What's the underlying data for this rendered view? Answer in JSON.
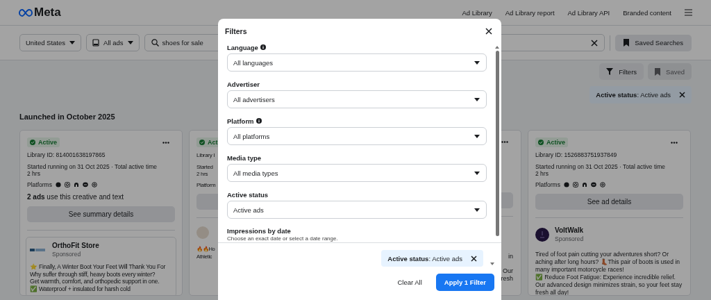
{
  "header": {
    "logo": "Meta",
    "nav": [
      "Ad Library",
      "Ad Library report",
      "Ad Library API",
      "Branded content"
    ]
  },
  "search_bar": {
    "country": "United States",
    "ad_category": "All ads",
    "query": "shoes for sale",
    "saved_searches": "Saved Searches"
  },
  "toolbar": {
    "filters": "Filters",
    "saved": {
      "label": "Saved",
      "disabled": true
    }
  },
  "active_filter_chip": "**Active status**: Active ads",
  "section_title": "Launched in October 2025",
  "cards": [
    {
      "kind": "full",
      "status": "Active",
      "library_id": "Library ID: 814001638197865",
      "started": "Started running on 31 Oct 2025 · Total active time",
      "duration": "2 hrs",
      "platforms_label": "Platforms",
      "summary": "**2 ads** use this creative and text",
      "button": "See summary details",
      "ad": {
        "framed": true,
        "advertiser": "OrthoFit Store",
        "sponsored": "Sponsored",
        "body": "⭐ Finally, A Winter Boot Your Feet Will Thank You For\nWhy suffer through stiff, heavy boots every winter?\nGet warmth, comfort, and orthopedic support in one.\n✅ Waterproof + insulated for harsh cold"
      }
    },
    {
      "kind": "clipped_left",
      "status": "Act",
      "lines": [
        "Library I",
        "Started",
        "2 hrs",
        "Platform"
      ],
      "ad_lines": [
        "🔥🔥Ho",
        "Athletic"
      ]
    },
    {
      "kind": "clipped_right",
      "lines": [
        "in",
        "Our",
        "resh"
      ]
    },
    {
      "kind": "full",
      "status": "Active",
      "library_id": "Library ID: 1526883751937849",
      "started": "Started running on 31 Oct 2025 · Total active time",
      "duration": "2 hrs",
      "platforms_label": "Platforms",
      "button": "See ad details",
      "ad": {
        "framed": false,
        "advertiser": "VoltWalk",
        "sponsored": "Sponsored",
        "body": "Tired of foot pain cutting your adventures short? Or aching after long hours? 👢This pair of boots is used in many important motorcycle races!\n✅ Reduce Foot Fatigue: Experience incredible relief. Our advanced design minimizes strain, so your feet stay fresh all day!"
      }
    }
  ],
  "filters_dialog": {
    "title": "Filters",
    "fields": [
      {
        "label": "Language",
        "info": true,
        "value": "All languages"
      },
      {
        "label": "Advertiser",
        "info": false,
        "value": "All advertisers"
      },
      {
        "label": "Platform",
        "info": true,
        "value": "All platforms"
      },
      {
        "label": "Media type",
        "info": false,
        "value": "All media types"
      },
      {
        "label": "Active status",
        "info": false,
        "value": "Active ads"
      }
    ],
    "date_section": {
      "label": "Impressions by date",
      "hint": "Choose an exact date or select a date range."
    },
    "chip": "**Active status**: Active ads",
    "clear_button": "Clear All",
    "apply_button": "Apply 1 Filter"
  }
}
